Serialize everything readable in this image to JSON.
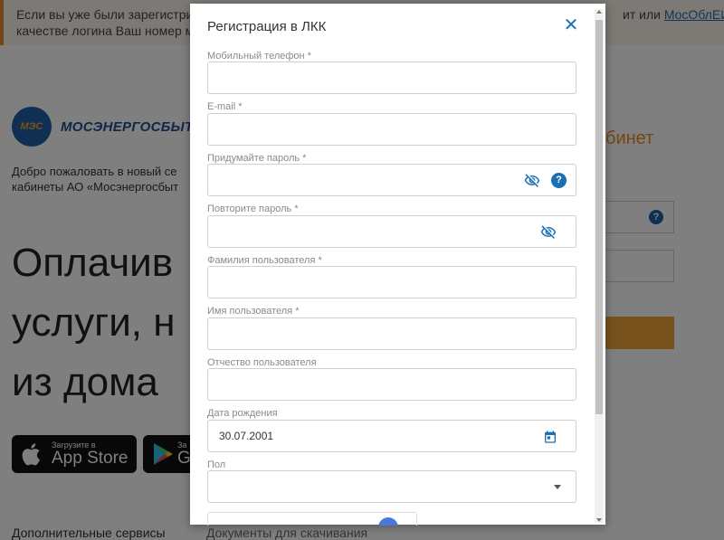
{
  "background": {
    "notice_line1": "Если вы уже были зарегистри",
    "notice_line2": "качестве логина Ваш номер м",
    "notice_right_text": "ит или ",
    "notice_link": "МосОблЕИРЦ,",
    "logo_badge": "МЭС",
    "logo_name": "МОСЭНЕРГОСБЫТ",
    "welcome_text": "Добро пожаловать в новый се кабинеты АО «Мосэнергосбыт",
    "headline_line1": "Оплачив",
    "headline_line2": "услуги, н",
    "headline_line3": "из дома",
    "appstore_small": "Загрузите в",
    "appstore_big": "App Store",
    "googleplay_small": "За",
    "googleplay_big": "G",
    "bottom_link": "Дополнительные сервисы",
    "login_title": "бинет"
  },
  "modal": {
    "title": "Регистрация в ЛКК",
    "fields": {
      "phone_label": "Мобильный телефон *",
      "email_label": "E-mail *",
      "password_label": "Придумайте пароль *",
      "password_repeat_label": "Повторите пароль *",
      "last_name_label": "Фамилия пользователя *",
      "first_name_label": "Имя пользователя *",
      "middle_name_label": "Отчество пользователя",
      "birth_date_label": "Дата рождения",
      "birth_date_value": "30.07.2001",
      "gender_label": "Пол"
    },
    "help_symbol": "?",
    "docs_label": "Документы для скачивания"
  },
  "colors": {
    "accent_blue": "#1a6fb5",
    "accent_orange": "#e98a2b"
  },
  "icons": {
    "close": "close-icon",
    "eye_hidden": "eye-off-icon",
    "help": "question-circle-icon",
    "calendar": "calendar-icon",
    "dropdown": "chevron-down-icon"
  }
}
